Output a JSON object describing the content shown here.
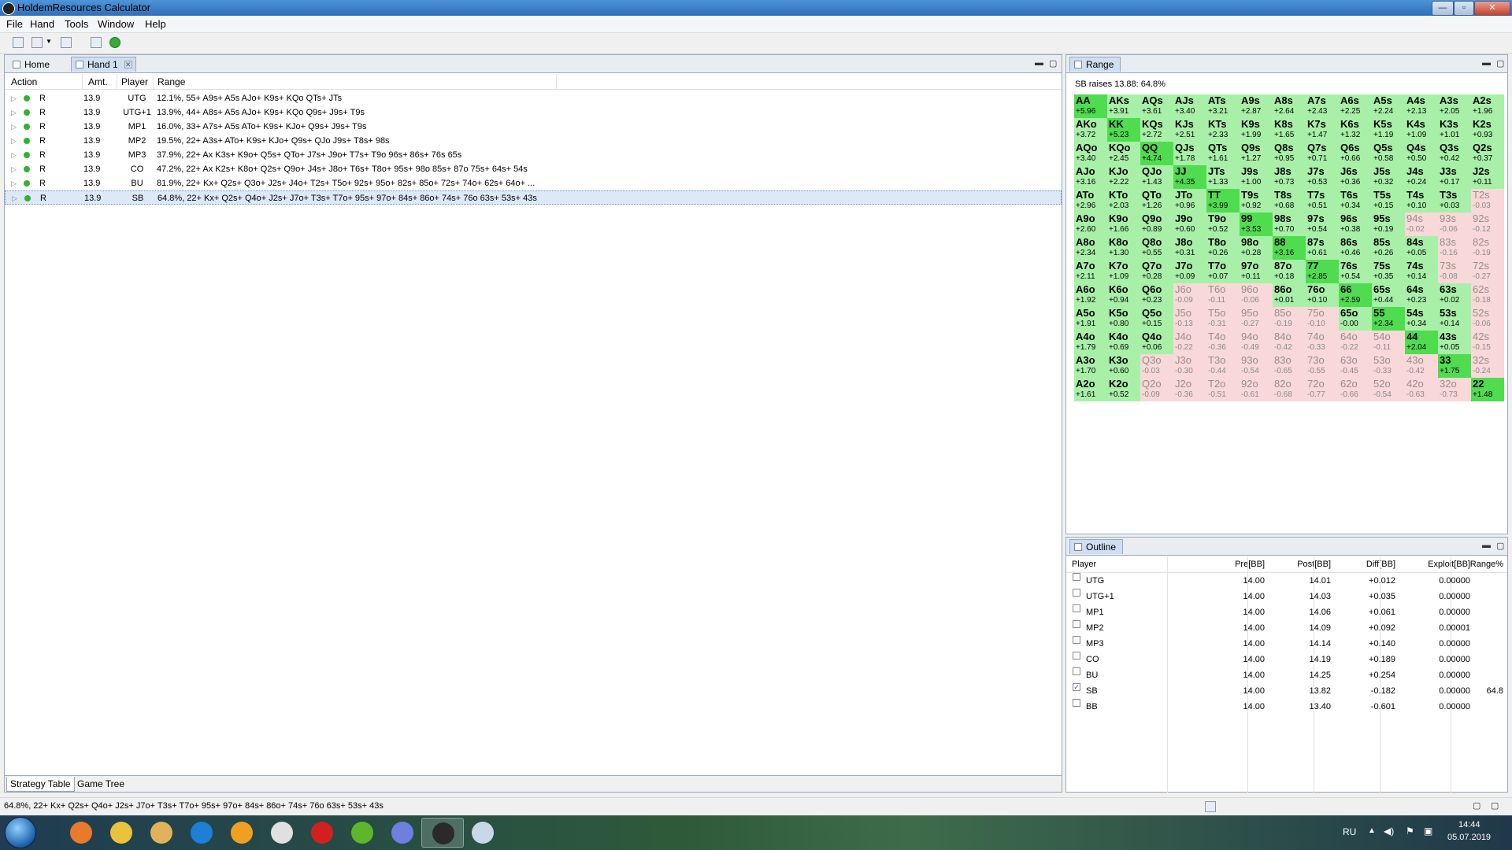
{
  "window": {
    "title": "HoldemResources Calculator",
    "min": "—",
    "max": "▫",
    "close": "✕"
  },
  "menu": [
    "File",
    "Hand",
    "Tools",
    "Window",
    "Help"
  ],
  "editor_tabs": [
    {
      "label": "Home",
      "active": false
    },
    {
      "label": "Hand 1",
      "active": true,
      "close": "✕"
    }
  ],
  "panel_controls": {
    "minimize": "▬",
    "maximize": "▢"
  },
  "action_table": {
    "headers": [
      "Action",
      "Amt.",
      "Player",
      "Range"
    ],
    "rows": [
      {
        "expander": "▷",
        "action": "R",
        "amt": "13.9",
        "player": "UTG",
        "range": "12.1%, 55+ A9s+ A5s AJo+ K9s+ KQo QTs+ JTs"
      },
      {
        "expander": "▷",
        "action": "R",
        "amt": "13.9",
        "player": "UTG+1",
        "range": "13.9%, 44+ A8s+ A5s AJo+ K9s+ KQo Q9s+ J9s+ T9s"
      },
      {
        "expander": "▷",
        "action": "R",
        "amt": "13.9",
        "player": "MP1",
        "range": "16.0%, 33+ A7s+ A5s ATo+ K9s+ KJo+ Q9s+ J9s+ T9s"
      },
      {
        "expander": "▷",
        "action": "R",
        "amt": "13.9",
        "player": "MP2",
        "range": "19.5%, 22+ A3s+ ATo+ K9s+ KJo+ Q9s+ QJo J9s+ T8s+ 98s"
      },
      {
        "expander": "▷",
        "action": "R",
        "amt": "13.9",
        "player": "MP3",
        "range": "37.9%, 22+ Ax K3s+ K9o+ Q5s+ QTo+ J7s+ J9o+ T7s+ T9o 96s+ 86s+ 76s 65s"
      },
      {
        "expander": "▷",
        "action": "R",
        "amt": "13.9",
        "player": "CO",
        "range": "47.2%, 22+ Ax K2s+ K8o+ Q2s+ Q9o+ J4s+ J8o+ T6s+ T8o+ 95s+ 98o 85s+ 87o 75s+ 64s+ 54s"
      },
      {
        "expander": "▷",
        "action": "R",
        "amt": "13.9",
        "player": "BU",
        "range": "81.9%, 22+ Kx+ Q2s+ Q3o+ J2s+ J4o+ T2s+ T5o+ 92s+ 95o+ 82s+ 85o+ 72s+ 74o+ 62s+ 64o+ ..."
      },
      {
        "expander": "▷",
        "action": "R",
        "amt": "13.9",
        "player": "SB",
        "range": "64.8%, 22+ Kx+ Q2s+ Q4o+ J2s+ J7o+ T3s+ T7o+ 95s+ 97o+ 84s+ 86o+ 74s+ 76o 63s+ 53s+ 43s",
        "selected": true
      }
    ]
  },
  "bottom_tabs": [
    "Strategy Table",
    "Game Tree"
  ],
  "range_panel": {
    "tab": "Range",
    "caption": "SB raises 13.88: 64.8%",
    "cells": [
      [
        "AA",
        "+5.96"
      ],
      [
        "AKs",
        "+3.91"
      ],
      [
        "AQs",
        "+3.61"
      ],
      [
        "AJs",
        "+3.40"
      ],
      [
        "ATs",
        "+3.21"
      ],
      [
        "A9s",
        "+2.87"
      ],
      [
        "A8s",
        "+2.64"
      ],
      [
        "A7s",
        "+2.43"
      ],
      [
        "A6s",
        "+2.25"
      ],
      [
        "A5s",
        "+2.24"
      ],
      [
        "A4s",
        "+2.13"
      ],
      [
        "A3s",
        "+2.05"
      ],
      [
        "A2s",
        "+1.96"
      ],
      [
        "AKo",
        "+3.72"
      ],
      [
        "KK",
        "+5.23"
      ],
      [
        "KQs",
        "+2.72"
      ],
      [
        "KJs",
        "+2.51"
      ],
      [
        "KTs",
        "+2.33"
      ],
      [
        "K9s",
        "+1.99"
      ],
      [
        "K8s",
        "+1.65"
      ],
      [
        "K7s",
        "+1.47"
      ],
      [
        "K6s",
        "+1.32"
      ],
      [
        "K5s",
        "+1.19"
      ],
      [
        "K4s",
        "+1.09"
      ],
      [
        "K3s",
        "+1.01"
      ],
      [
        "K2s",
        "+0.93"
      ],
      [
        "AQo",
        "+3.40"
      ],
      [
        "KQo",
        "+2.45"
      ],
      [
        "QQ",
        "+4.74"
      ],
      [
        "QJs",
        "+1.78"
      ],
      [
        "QTs",
        "+1.61"
      ],
      [
        "Q9s",
        "+1.27"
      ],
      [
        "Q8s",
        "+0.95"
      ],
      [
        "Q7s",
        "+0.71"
      ],
      [
        "Q6s",
        "+0.66"
      ],
      [
        "Q5s",
        "+0.58"
      ],
      [
        "Q4s",
        "+0.50"
      ],
      [
        "Q3s",
        "+0.42"
      ],
      [
        "Q2s",
        "+0.37"
      ],
      [
        "AJo",
        "+3.16"
      ],
      [
        "KJo",
        "+2.22"
      ],
      [
        "QJo",
        "+1.43"
      ],
      [
        "JJ",
        "+4.35"
      ],
      [
        "JTs",
        "+1.33"
      ],
      [
        "J9s",
        "+1.00"
      ],
      [
        "J8s",
        "+0.73"
      ],
      [
        "J7s",
        "+0.53"
      ],
      [
        "J6s",
        "+0.36"
      ],
      [
        "J5s",
        "+0.32"
      ],
      [
        "J4s",
        "+0.24"
      ],
      [
        "J3s",
        "+0.17"
      ],
      [
        "J2s",
        "+0.11"
      ],
      [
        "ATo",
        "+2.96"
      ],
      [
        "KTo",
        "+2.03"
      ],
      [
        "QTo",
        "+1.26"
      ],
      [
        "JTo",
        "+0.96"
      ],
      [
        "TT",
        "+3.99"
      ],
      [
        "T9s",
        "+0.92"
      ],
      [
        "T8s",
        "+0.68"
      ],
      [
        "T7s",
        "+0.51"
      ],
      [
        "T6s",
        "+0.34"
      ],
      [
        "T5s",
        "+0.15"
      ],
      [
        "T4s",
        "+0.10"
      ],
      [
        "T3s",
        "+0.03"
      ],
      [
        "T2s",
        "-0.03"
      ],
      [
        "A9o",
        "+2.60"
      ],
      [
        "K9o",
        "+1.66"
      ],
      [
        "Q9o",
        "+0.89"
      ],
      [
        "J9o",
        "+0.60"
      ],
      [
        "T9o",
        "+0.52"
      ],
      [
        "99",
        "+3.53"
      ],
      [
        "98s",
        "+0.70"
      ],
      [
        "97s",
        "+0.54"
      ],
      [
        "96s",
        "+0.38"
      ],
      [
        "95s",
        "+0.19"
      ],
      [
        "94s",
        "-0.02"
      ],
      [
        "93s",
        "-0.06"
      ],
      [
        "92s",
        "-0.12"
      ],
      [
        "A8o",
        "+2.34"
      ],
      [
        "K8o",
        "+1.30"
      ],
      [
        "Q8o",
        "+0.55"
      ],
      [
        "J8o",
        "+0.31"
      ],
      [
        "T8o",
        "+0.26"
      ],
      [
        "98o",
        "+0.28"
      ],
      [
        "88",
        "+3.16"
      ],
      [
        "87s",
        "+0.61"
      ],
      [
        "86s",
        "+0.46"
      ],
      [
        "85s",
        "+0.26"
      ],
      [
        "84s",
        "+0.05"
      ],
      [
        "83s",
        "-0.16"
      ],
      [
        "82s",
        "-0.19"
      ],
      [
        "A7o",
        "+2.11"
      ],
      [
        "K7o",
        "+1.09"
      ],
      [
        "Q7o",
        "+0.28"
      ],
      [
        "J7o",
        "+0.09"
      ],
      [
        "T7o",
        "+0.07"
      ],
      [
        "97o",
        "+0.11"
      ],
      [
        "87o",
        "+0.18"
      ],
      [
        "77",
        "+2.85"
      ],
      [
        "76s",
        "+0.54"
      ],
      [
        "75s",
        "+0.35"
      ],
      [
        "74s",
        "+0.14"
      ],
      [
        "73s",
        "-0.08"
      ],
      [
        "72s",
        "-0.27"
      ],
      [
        "A6o",
        "+1.92"
      ],
      [
        "K6o",
        "+0.94"
      ],
      [
        "Q6o",
        "+0.23"
      ],
      [
        "J6o",
        "-0.09"
      ],
      [
        "T6o",
        "-0.11"
      ],
      [
        "96o",
        "-0.06"
      ],
      [
        "86o",
        "+0.01"
      ],
      [
        "76o",
        "+0.10"
      ],
      [
        "66",
        "+2.59"
      ],
      [
        "65s",
        "+0.44"
      ],
      [
        "64s",
        "+0.23"
      ],
      [
        "63s",
        "+0.02"
      ],
      [
        "62s",
        "-0.18"
      ],
      [
        "A5o",
        "+1.91"
      ],
      [
        "K5o",
        "+0.80"
      ],
      [
        "Q5o",
        "+0.15"
      ],
      [
        "J5o",
        "-0.13"
      ],
      [
        "T5o",
        "-0.31"
      ],
      [
        "95o",
        "-0.27"
      ],
      [
        "85o",
        "-0.19"
      ],
      [
        "75o",
        "-0.10"
      ],
      [
        "65o",
        "-0.00"
      ],
      [
        "55",
        "+2.34"
      ],
      [
        "54s",
        "+0.34"
      ],
      [
        "53s",
        "+0.14"
      ],
      [
        "52s",
        "-0.06"
      ],
      [
        "A4o",
        "+1.79"
      ],
      [
        "K4o",
        "+0.69"
      ],
      [
        "Q4o",
        "+0.06"
      ],
      [
        "J4o",
        "-0.22"
      ],
      [
        "T4o",
        "-0.36"
      ],
      [
        "94o",
        "-0.49"
      ],
      [
        "84o",
        "-0.42"
      ],
      [
        "74o",
        "-0.33"
      ],
      [
        "64o",
        "-0.22"
      ],
      [
        "54o",
        "-0.11"
      ],
      [
        "44",
        "+2.04"
      ],
      [
        "43s",
        "+0.05"
      ],
      [
        "42s",
        "-0.15"
      ],
      [
        "A3o",
        "+1.70"
      ],
      [
        "K3o",
        "+0.60"
      ],
      [
        "Q3o",
        "-0.03"
      ],
      [
        "J3o",
        "-0.30"
      ],
      [
        "T3o",
        "-0.44"
      ],
      [
        "93o",
        "-0.54"
      ],
      [
        "83o",
        "-0.65"
      ],
      [
        "73o",
        "-0.55"
      ],
      [
        "63o",
        "-0.45"
      ],
      [
        "53o",
        "-0.33"
      ],
      [
        "43o",
        "-0.42"
      ],
      [
        "33",
        "+1.75"
      ],
      [
        "32s",
        "-0.24"
      ],
      [
        "A2o",
        "+1.61"
      ],
      [
        "K2o",
        "+0.52"
      ],
      [
        "Q2o",
        "-0.09"
      ],
      [
        "J2o",
        "-0.36"
      ],
      [
        "T2o",
        "-0.51"
      ],
      [
        "92o",
        "-0.61"
      ],
      [
        "82o",
        "-0.68"
      ],
      [
        "72o",
        "-0.77"
      ],
      [
        "62o",
        "-0.66"
      ],
      [
        "52o",
        "-0.54"
      ],
      [
        "42o",
        "-0.63"
      ],
      [
        "32o",
        "-0.73"
      ],
      [
        "22",
        "+1.48"
      ]
    ],
    "in_range": [
      [
        1,
        1,
        1,
        1,
        1,
        1,
        1,
        1,
        1,
        1,
        1,
        1,
        1
      ],
      [
        1,
        1,
        1,
        1,
        1,
        1,
        1,
        1,
        1,
        1,
        1,
        1,
        1
      ],
      [
        1,
        1,
        1,
        1,
        1,
        1,
        1,
        1,
        1,
        1,
        1,
        1,
        1
      ],
      [
        1,
        1,
        1,
        1,
        1,
        1,
        1,
        1,
        1,
        1,
        1,
        1,
        1
      ],
      [
        1,
        1,
        1,
        1,
        1,
        1,
        1,
        1,
        1,
        1,
        1,
        1,
        0
      ],
      [
        1,
        1,
        1,
        1,
        1,
        1,
        1,
        1,
        1,
        1,
        0,
        0,
        0
      ],
      [
        1,
        1,
        1,
        1,
        1,
        1,
        1,
        1,
        1,
        1,
        1,
        0,
        0
      ],
      [
        1,
        1,
        1,
        1,
        1,
        1,
        1,
        1,
        1,
        1,
        1,
        0,
        0
      ],
      [
        1,
        1,
        1,
        0,
        0,
        0,
        1,
        1,
        1,
        1,
        1,
        1,
        0
      ],
      [
        1,
        1,
        1,
        0,
        0,
        0,
        0,
        0,
        1,
        1,
        1,
        1,
        0
      ],
      [
        1,
        1,
        1,
        0,
        0,
        0,
        0,
        0,
        0,
        0,
        1,
        1,
        0
      ],
      [
        1,
        1,
        0,
        0,
        0,
        0,
        0,
        0,
        0,
        0,
        0,
        1,
        0
      ],
      [
        1,
        1,
        0,
        0,
        0,
        0,
        0,
        0,
        0,
        0,
        0,
        0,
        1
      ]
    ],
    "colors": {
      "strong": "#4fdc4f",
      "in_range": "#a8f0a8",
      "out_of_range": "#f8d8d8"
    }
  },
  "outline_panel": {
    "tab": "Outline",
    "headers": [
      "Player",
      "Pre[BB]",
      "Post[BB]",
      "Diff[BB]",
      "Exploit[BB]",
      "Range%"
    ],
    "rows": [
      {
        "checked": "",
        "player": "UTG",
        "pre": "14.00",
        "post": "14.01",
        "diff": "+0.012",
        "exploit": "0.00000",
        "range": ""
      },
      {
        "checked": "",
        "player": "UTG+1",
        "pre": "14.00",
        "post": "14.03",
        "diff": "+0.035",
        "exploit": "0.00000",
        "range": ""
      },
      {
        "checked": "",
        "player": "MP1",
        "pre": "14.00",
        "post": "14.06",
        "diff": "+0.061",
        "exploit": "0.00000",
        "range": ""
      },
      {
        "checked": "",
        "player": "MP2",
        "pre": "14.00",
        "post": "14.09",
        "diff": "+0.092",
        "exploit": "0.00001",
        "range": ""
      },
      {
        "checked": "",
        "player": "MP3",
        "pre": "14.00",
        "post": "14.14",
        "diff": "+0.140",
        "exploit": "0.00000",
        "range": ""
      },
      {
        "checked": "",
        "player": "CO",
        "pre": "14.00",
        "post": "14.19",
        "diff": "+0.189",
        "exploit": "0.00000",
        "range": ""
      },
      {
        "checked": "",
        "player": "BU",
        "pre": "14.00",
        "post": "14.25",
        "diff": "+0.254",
        "exploit": "0.00000",
        "range": ""
      },
      {
        "checked": "✓",
        "player": "SB",
        "pre": "14.00",
        "post": "13.82",
        "diff": "-0.182",
        "exploit": "0.00000",
        "range": "64.8"
      },
      {
        "checked": "",
        "player": "BB",
        "pre": "14.00",
        "post": "13.40",
        "diff": "-0.601",
        "exploit": "0.00000",
        "range": ""
      }
    ]
  },
  "status": {
    "text": "64.8%, 22+ Kx+ Q2s+ Q4o+ J2s+ J7o+ T3s+ T7o+ 95s+ 97o+ 84s+ 86o+ 74s+ 76o 63s+ 53s+ 43s"
  },
  "taskbar": {
    "apps": [
      "media-player-icon",
      "chrome-icon",
      "file-explorer-icon",
      "internet-explorer-icon",
      "settings-app-icon",
      "notepad-icon",
      "opera-icon",
      "utorrent-icon",
      "discord-icon",
      "holdemresources-icon",
      "paint-icon"
    ],
    "active_app": "holdemresources-icon",
    "language": "RU",
    "time": "14:44",
    "date": "05.07.2019"
  }
}
